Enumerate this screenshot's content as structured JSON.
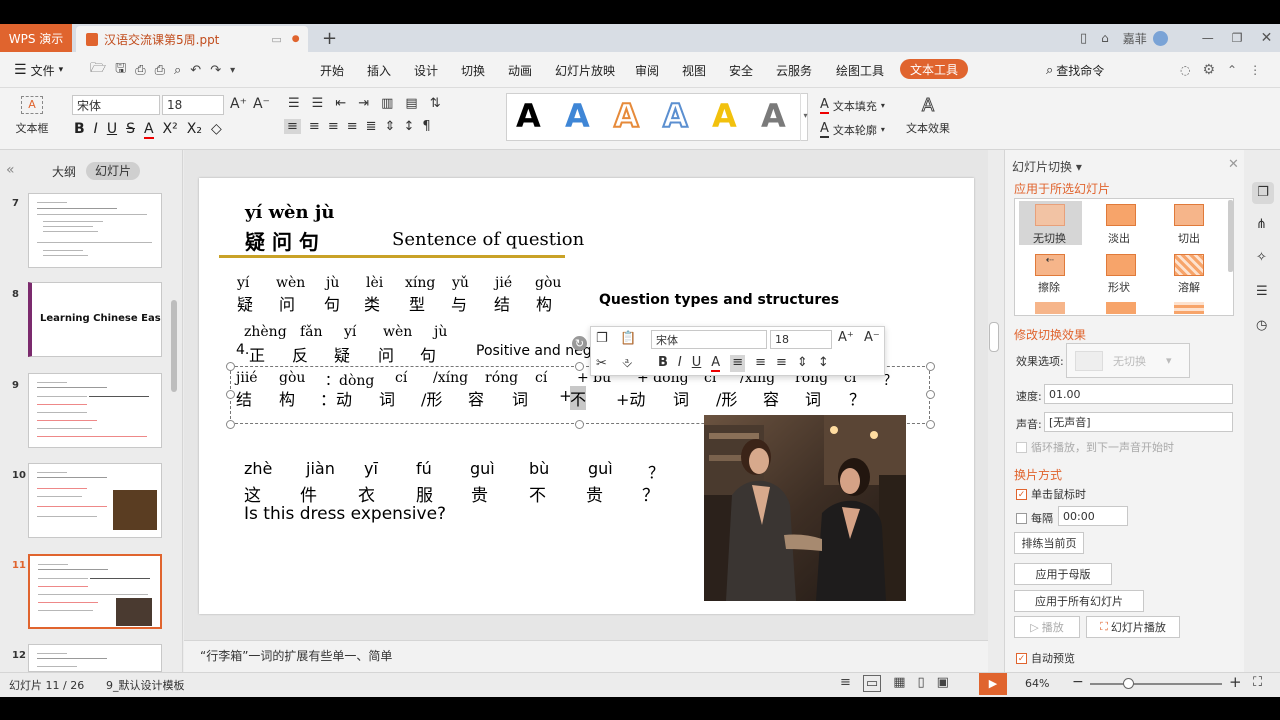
{
  "titlebar": {
    "app_tab": "WPS 演示",
    "doc_tab": "汉语交流课第5周.ppt",
    "user": "嘉菲"
  },
  "menu": {
    "file": "文件",
    "items": [
      "开始",
      "插入",
      "设计",
      "切换",
      "动画",
      "幻灯片放映",
      "审阅",
      "视图",
      "安全",
      "云服务",
      "绘图工具"
    ],
    "active": "文本工具",
    "search": "查找命令"
  },
  "ribbon": {
    "textbox_label": "文本框",
    "font": "宋体",
    "size": "18",
    "text_fill": "文本填充",
    "text_outline": "文本轮廓",
    "text_effect": "文本效果",
    "style_letter": "A"
  },
  "leftpanel": {
    "tab_outline": "大纲",
    "tab_slides": "幻灯片",
    "thumbs": [
      {
        "num": "7"
      },
      {
        "num": "8",
        "title": "Learning Chinese Easily"
      },
      {
        "num": "9"
      },
      {
        "num": "10"
      },
      {
        "num": "11"
      },
      {
        "num": "12"
      }
    ]
  },
  "slide": {
    "title_pinyin": "yí   wèn   jù",
    "title_hanzi": "疑 问  句",
    "title_en": "Sentence of question",
    "row1_pinyin": [
      "yí",
      "wèn",
      "jù",
      "lèi",
      "xíng",
      "yǔ",
      "jié",
      "gòu"
    ],
    "row1_hanzi": [
      "疑",
      "问",
      "句",
      "类",
      "型",
      "与",
      "结",
      "构"
    ],
    "row1_en": "Question types and structures",
    "row2_pinyin": [
      "zhèng",
      "fǎn",
      "yí",
      "wèn",
      "jù"
    ],
    "row2_num": "4.",
    "row2_hanzi": [
      "正",
      "反",
      "疑",
      "问",
      "句"
    ],
    "row2_en": "Positive and nega",
    "row3_pinyin": [
      "jiié",
      "gòu",
      "：dòng",
      "cí",
      "/xíng",
      "róng",
      "cí",
      "+ bù",
      "+ dòng",
      "cí",
      "/xíng",
      "róng",
      "cí",
      "？"
    ],
    "row3_hanzi": [
      "结",
      "构",
      "：动",
      "词",
      "/形",
      "容",
      "词",
      "+",
      "不",
      "+动",
      "词",
      "/形",
      "容",
      "词",
      "？"
    ],
    "row4_pinyin": [
      "zhè",
      "jiàn",
      "yī",
      "fú",
      "guì",
      "bù",
      "guì",
      "？"
    ],
    "row4_hanzi": [
      "这",
      "件",
      "衣",
      "服",
      "贵",
      "不",
      "贵",
      "？"
    ],
    "row4_en": "Is this dress expensive?"
  },
  "floating_toolbar": {
    "font": "宋体",
    "size": "18"
  },
  "notes": "“行李箱”一词的扩展有些单一、简单",
  "rightpanel": {
    "title": "幻灯片切换",
    "apply_selected": "应用于所选幻灯片",
    "transitions": [
      "无切换",
      "淡出",
      "切出",
      "擦除",
      "形状",
      "溶解"
    ],
    "modify": "修改切换效果",
    "effect_label": "效果选项:",
    "effect_value": "无切换",
    "speed_label": "速度:",
    "speed_value": "01.00",
    "sound_label": "声音:",
    "sound_value": "[无声音]",
    "loop_label": "循环播放，到下一声音开始时",
    "advance": "换片方式",
    "on_click": "单击鼠标时",
    "every": "每隔",
    "every_value": "00:00",
    "rehearse": "排练当前页",
    "apply_master": "应用于母版",
    "apply_all": "应用于所有幻灯片",
    "play": "播放",
    "slideshow": "幻灯片播放",
    "auto_preview": "自动预览"
  },
  "status": {
    "slide_info": "幻灯片 11 / 26",
    "template": "9_默认设计模板",
    "zoom": "64%"
  },
  "colors": {
    "accent": "#e0642e",
    "title_underline": "#c9a227"
  }
}
